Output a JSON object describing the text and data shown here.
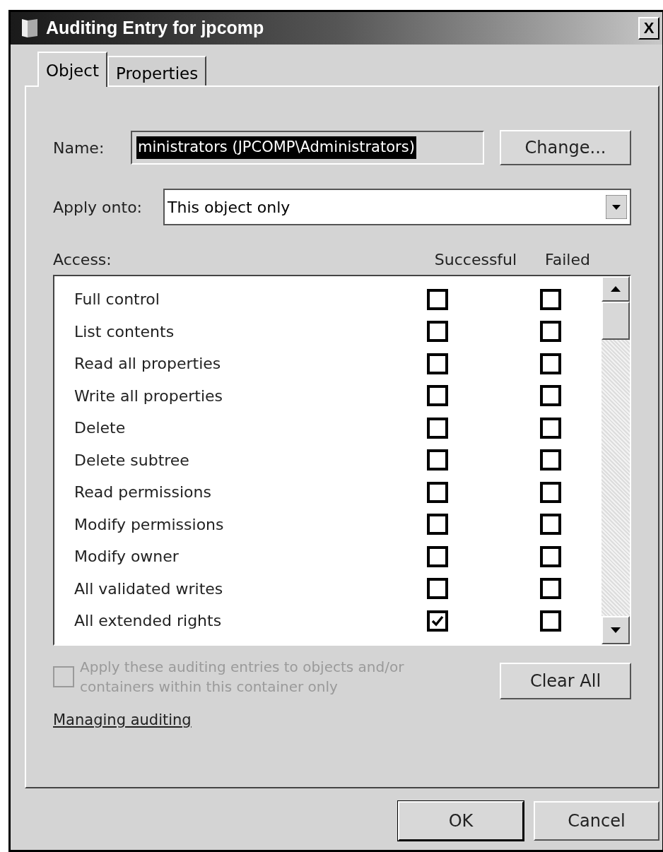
{
  "window": {
    "title": "Auditing Entry for jpcomp",
    "close": "X"
  },
  "tabs": [
    {
      "label": "Object",
      "selected": true
    },
    {
      "label": "Properties",
      "selected": false
    }
  ],
  "name_row": {
    "label": "Name:",
    "value": "ministrators (JPCOMP\\Administrators)",
    "highlighted": true,
    "button": "Change..."
  },
  "apply_onto": {
    "label": "Apply onto:",
    "value": "This object only"
  },
  "access": {
    "label": "Access:",
    "columns": [
      "Successful",
      "Failed"
    ],
    "rows": [
      {
        "name": "Full control",
        "successful": false,
        "failed": false
      },
      {
        "name": "List contents",
        "successful": false,
        "failed": false
      },
      {
        "name": "Read all properties",
        "successful": false,
        "failed": false
      },
      {
        "name": "Write all properties",
        "successful": false,
        "failed": false
      },
      {
        "name": "Delete",
        "successful": false,
        "failed": false
      },
      {
        "name": "Delete subtree",
        "successful": false,
        "failed": false
      },
      {
        "name": "Read permissions",
        "successful": false,
        "failed": false
      },
      {
        "name": "Modify permissions",
        "successful": false,
        "failed": false
      },
      {
        "name": "Modify owner",
        "successful": false,
        "failed": false
      },
      {
        "name": "All validated writes",
        "successful": false,
        "failed": false
      },
      {
        "name": "All extended rights",
        "successful": true,
        "failed": false
      }
    ]
  },
  "apply_children": {
    "label": "Apply these auditing entries to objects and/or containers within this container only",
    "checked": false,
    "disabled": true
  },
  "clear_all": "Clear All",
  "link": "Managing auditing",
  "buttons": [
    {
      "label": "OK",
      "default": true
    },
    {
      "label": "Cancel",
      "default": false
    }
  ]
}
